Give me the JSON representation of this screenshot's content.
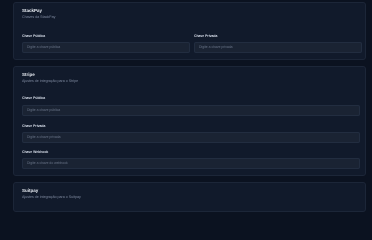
{
  "sections": [
    {
      "title": "StackPay",
      "description": "Chaves da StackPay",
      "fields": [
        {
          "label": "Chave Pública",
          "placeholder": "Digite a chave pública"
        },
        {
          "label": "Chave Privada",
          "placeholder": "Digite a chave privada"
        }
      ]
    },
    {
      "title": "Stripe",
      "description": "Ajustes de integração para o Stripe",
      "fields": [
        {
          "label": "Chave Pública",
          "placeholder": "Digite a chave pública"
        },
        {
          "label": "Chave Privada",
          "placeholder": "Digite a chave privada"
        },
        {
          "label": "Chave Webhook",
          "placeholder": "Digite a chave do webhook"
        }
      ]
    },
    {
      "title": "Suitpay",
      "description": "Ajustes de integração para o Suitpay"
    }
  ]
}
